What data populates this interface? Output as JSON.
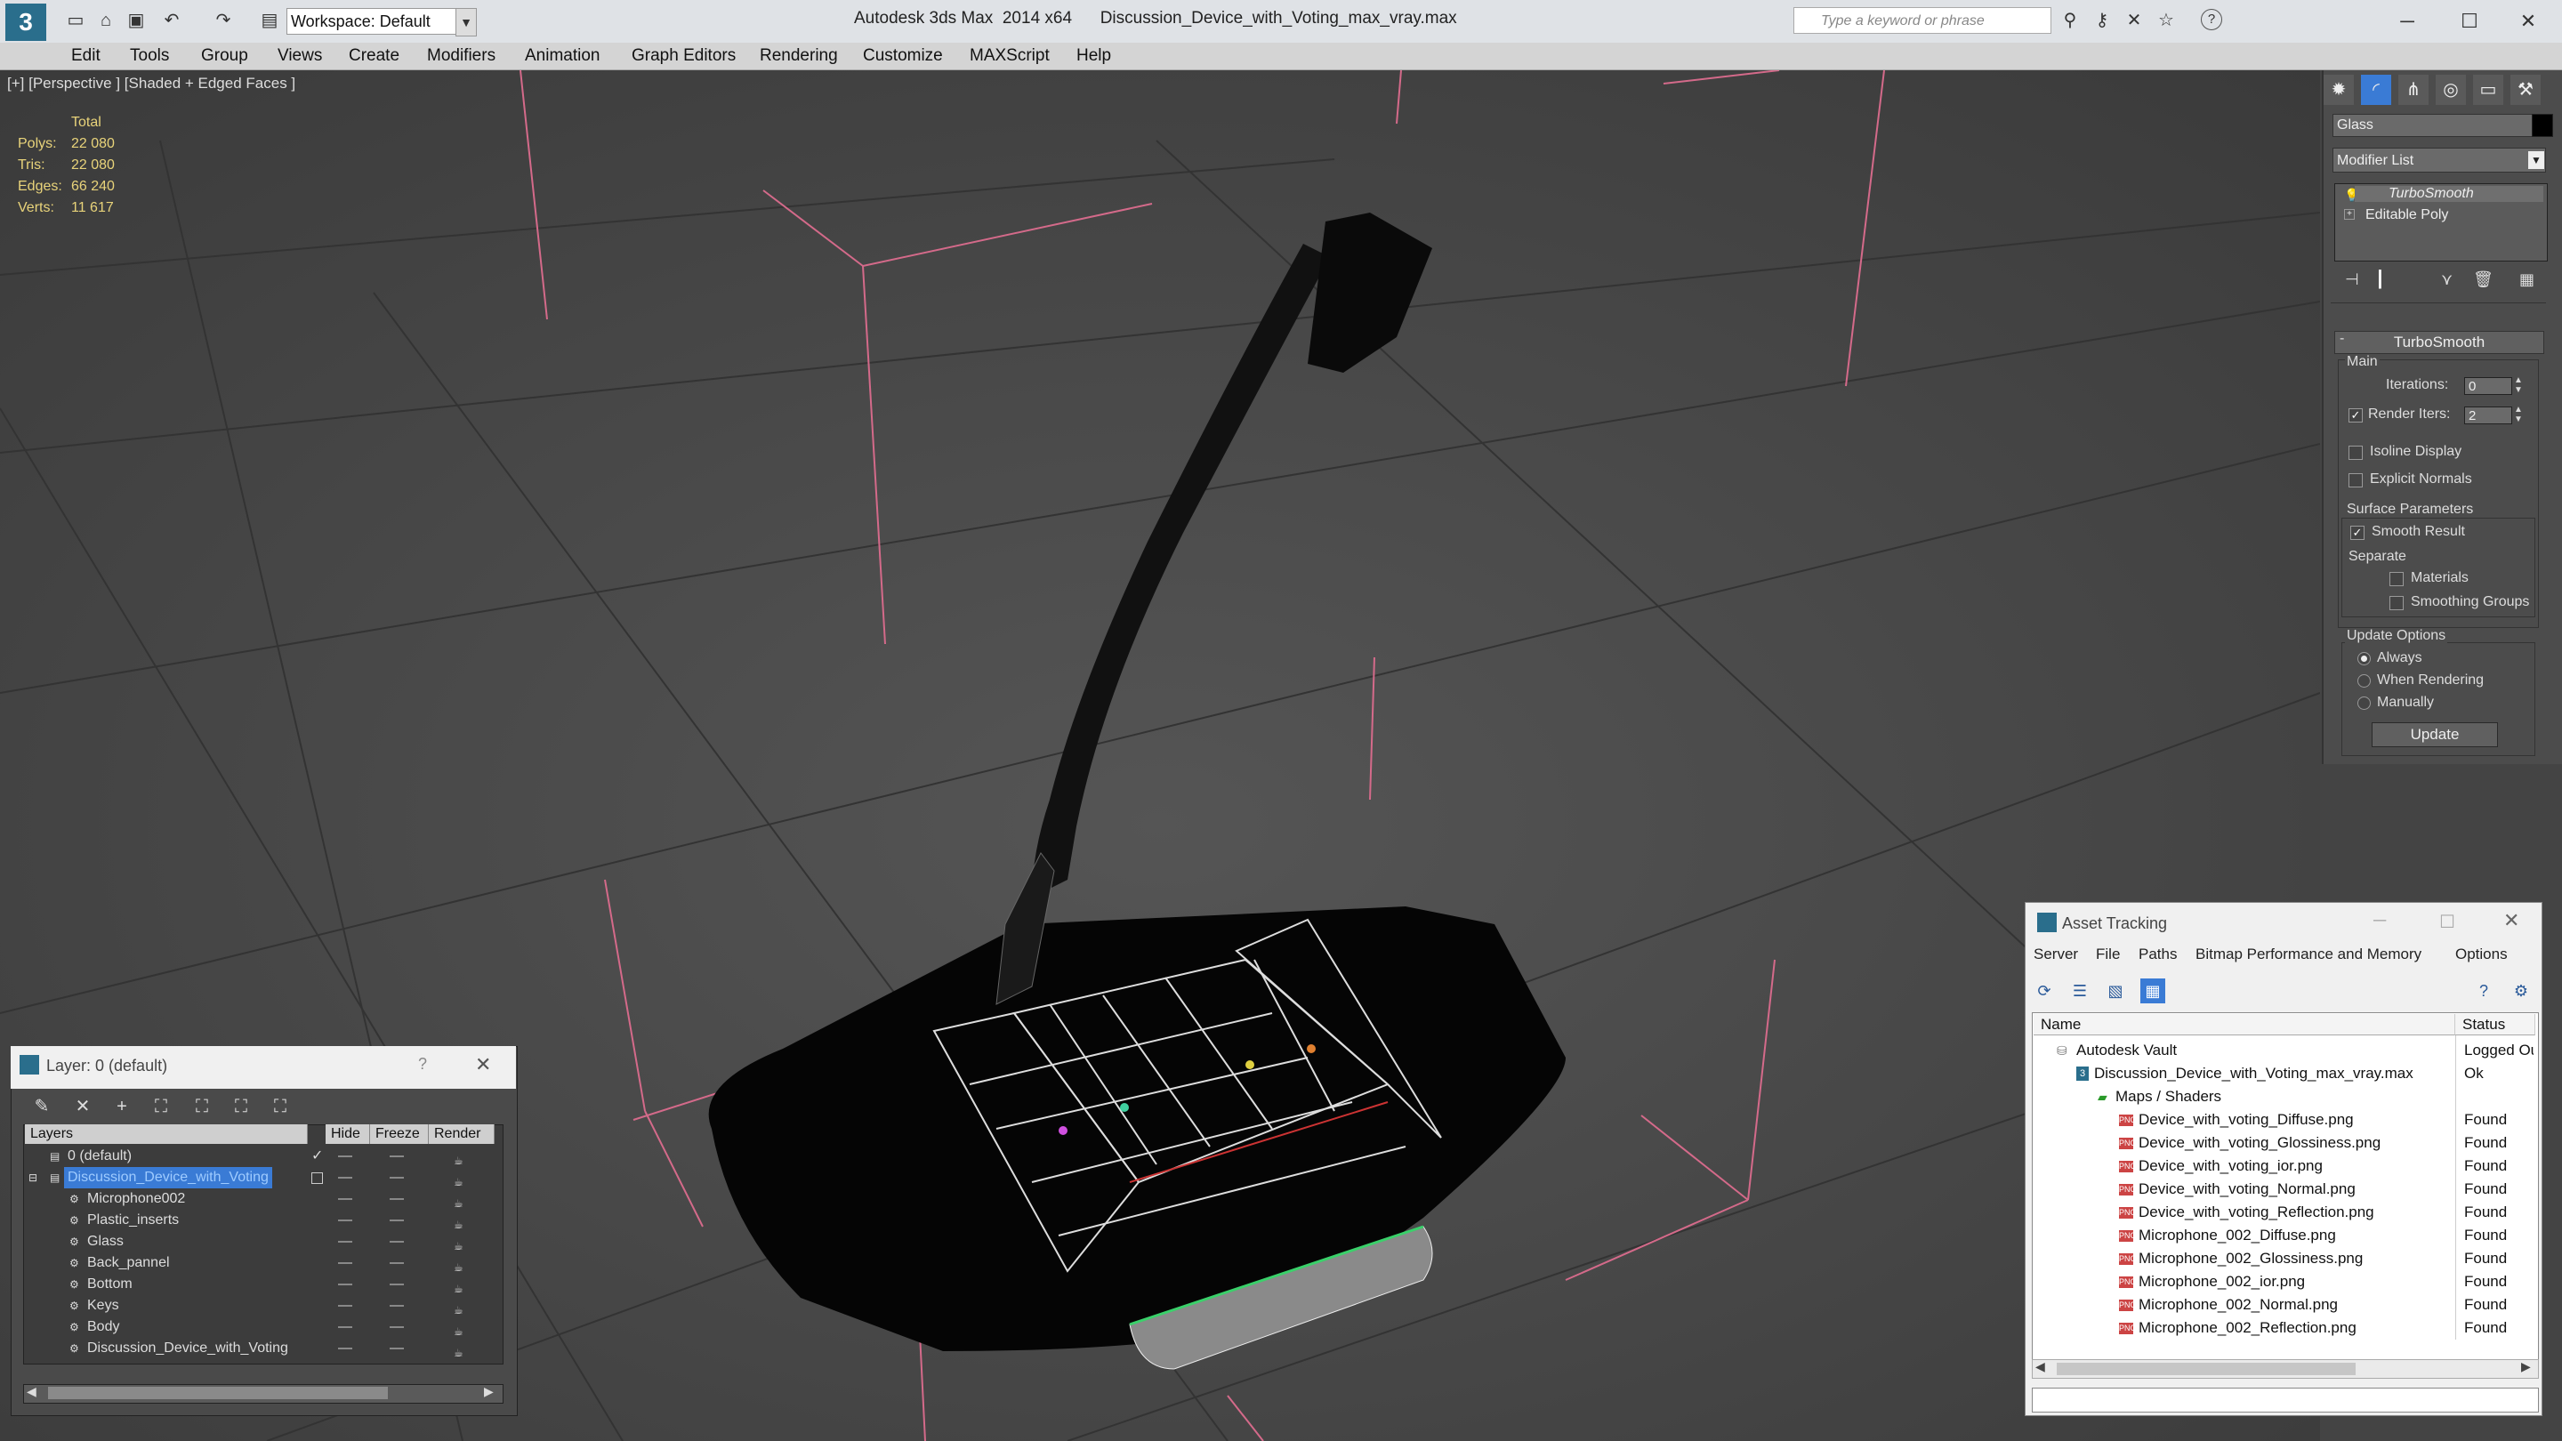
{
  "titlebar": {
    "app_logo": "3",
    "workspace_label": "Workspace: Default",
    "app_title": "Autodesk 3ds Max  2014 x64      Discussion_Device_with_Voting_max_vray.max",
    "search_placeholder": "Type a keyword or phrase",
    "help_icon": "?"
  },
  "menubar": {
    "items": [
      "Edit",
      "Tools",
      "Group",
      "Views",
      "Create",
      "Modifiers",
      "Animation",
      "Graph Editors",
      "Rendering",
      "Customize",
      "MAXScript",
      "Help"
    ]
  },
  "viewport": {
    "label": "[+] [Perspective ] [Shaded + Edged Faces ]",
    "stats": {
      "header": "Total",
      "polys_label": "Polys:",
      "polys": "22 080",
      "tris_label": "Tris:",
      "tris": "22 080",
      "edges_label": "Edges:",
      "edges": "66 240",
      "verts_label": "Verts:",
      "verts": "11 617"
    }
  },
  "command_panel": {
    "object_name": "Glass",
    "object_color": "#000000",
    "modifier_list": "Modifier List",
    "stack": [
      "TurboSmooth",
      "Editable Poly"
    ],
    "rollout_title": "TurboSmooth",
    "main_label": "Main",
    "iterations_label": "Iterations:",
    "iterations_value": "0",
    "render_iters_label": "Render Iters:",
    "render_iters_value": "2",
    "render_iters_checked": true,
    "isoline_label": "Isoline Display",
    "explicit_normals_label": "Explicit Normals",
    "surface_params_label": "Surface Parameters",
    "smooth_result_label": "Smooth Result",
    "separate_label": "Separate",
    "materials_label": "Materials",
    "smoothing_groups_label": "Smoothing Groups",
    "update_options_label": "Update Options",
    "always_label": "Always",
    "when_rendering_label": "When Rendering",
    "manually_label": "Manually",
    "update_button": "Update"
  },
  "layer_dialog": {
    "title": "Layer: 0 (default)",
    "help": "?",
    "columns": [
      "Layers",
      "Hide",
      "Freeze",
      "Render"
    ],
    "rows": [
      {
        "name": "0 (default)",
        "indent": 0,
        "selected": false
      },
      {
        "name": "Discussion_Device_with_Voting",
        "indent": 0,
        "selected": true
      },
      {
        "name": "Microphone002",
        "indent": 1,
        "selected": false
      },
      {
        "name": "Plastic_inserts",
        "indent": 1,
        "selected": false
      },
      {
        "name": "Glass",
        "indent": 1,
        "selected": false
      },
      {
        "name": "Back_pannel",
        "indent": 1,
        "selected": false
      },
      {
        "name": "Bottom",
        "indent": 1,
        "selected": false
      },
      {
        "name": "Keys",
        "indent": 1,
        "selected": false
      },
      {
        "name": "Body",
        "indent": 1,
        "selected": false
      },
      {
        "name": "Discussion_Device_with_Voting",
        "indent": 1,
        "selected": false
      }
    ]
  },
  "asset_tracking": {
    "title": "Asset Tracking",
    "menu": [
      "Server",
      "File",
      "Paths",
      "Bitmap Performance and Memory",
      "Options"
    ],
    "columns": [
      "Name",
      "Status"
    ],
    "rows": [
      {
        "name": "Autodesk Vault",
        "status": "Logged Out",
        "indent": 0
      },
      {
        "name": "Discussion_Device_with_Voting_max_vray.max",
        "status": "Ok",
        "indent": 1
      },
      {
        "name": "Maps / Shaders",
        "status": "",
        "indent": 2
      },
      {
        "name": "Device_with_voting_Diffuse.png",
        "status": "Found",
        "indent": 3
      },
      {
        "name": "Device_with_voting_Glossiness.png",
        "status": "Found",
        "indent": 3
      },
      {
        "name": "Device_with_voting_ior.png",
        "status": "Found",
        "indent": 3
      },
      {
        "name": "Device_with_voting_Normal.png",
        "status": "Found",
        "indent": 3
      },
      {
        "name": "Device_with_voting_Reflection.png",
        "status": "Found",
        "indent": 3
      },
      {
        "name": "Microphone_002_Diffuse.png",
        "status": "Found",
        "indent": 3
      },
      {
        "name": "Microphone_002_Glossiness.png",
        "status": "Found",
        "indent": 3
      },
      {
        "name": "Microphone_002_ior.png",
        "status": "Found",
        "indent": 3
      },
      {
        "name": "Microphone_002_Normal.png",
        "status": "Found",
        "indent": 3
      },
      {
        "name": "Microphone_002_Reflection.png",
        "status": "Found",
        "indent": 3
      }
    ]
  }
}
